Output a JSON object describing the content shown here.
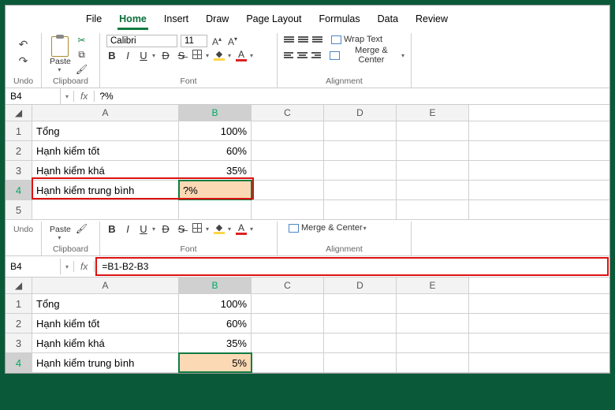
{
  "tabs": [
    "File",
    "Home",
    "Insert",
    "Draw",
    "Page Layout",
    "Formulas",
    "Data",
    "Review"
  ],
  "active_tab": "Home",
  "ribbon": {
    "undo_label": "Undo",
    "clipboard_label": "Clipboard",
    "paste_label": "Paste",
    "font_label": "Font",
    "font_name": "Calibri",
    "font_size": "11",
    "alignment_label": "Alignment",
    "wrap_text": "Wrap Text",
    "merge_center": "Merge & Center"
  },
  "top": {
    "name_box": "B4",
    "formula": "?%",
    "columns": [
      "A",
      "B",
      "C",
      "D",
      "E"
    ],
    "rows": [
      {
        "n": "1",
        "a": "Tổng",
        "b": "100%"
      },
      {
        "n": "2",
        "a": "Hạnh kiểm tốt",
        "b": "60%"
      },
      {
        "n": "3",
        "a": "Hạnh kiểm khá",
        "b": "35%"
      },
      {
        "n": "4",
        "a": "Hạnh kiểm trung bình",
        "b": "?%"
      },
      {
        "n": "5",
        "a": "",
        "b": ""
      }
    ]
  },
  "bottom": {
    "name_box": "B4",
    "formula": "=B1-B2-B3",
    "columns": [
      "A",
      "B",
      "C",
      "D",
      "E"
    ],
    "rows": [
      {
        "n": "1",
        "a": "Tổng",
        "b": "100%"
      },
      {
        "n": "2",
        "a": "Hạnh kiểm tốt",
        "b": "60%"
      },
      {
        "n": "3",
        "a": "Hạnh kiểm khá",
        "b": "35%"
      },
      {
        "n": "4",
        "a": "Hạnh kiểm trung bình",
        "b": "5%"
      }
    ]
  }
}
